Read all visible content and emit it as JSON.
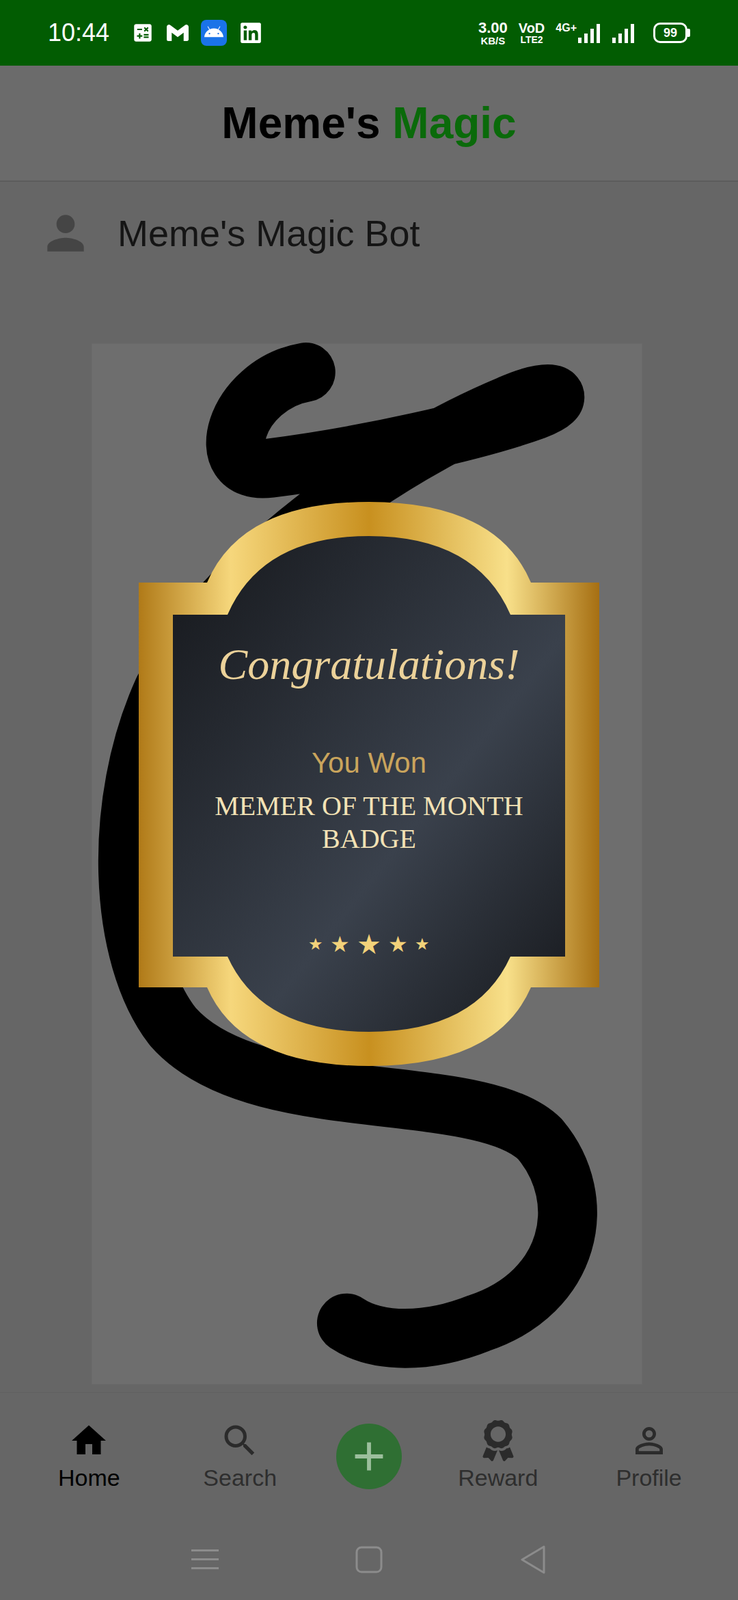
{
  "status_bar": {
    "time": "10:44",
    "net_speed": "3.00",
    "net_unit": "KB/S",
    "volte": "VoD",
    "volte_sub": "LTE2",
    "network": "4G+",
    "battery": "99"
  },
  "header": {
    "title_part1": "Meme's",
    "title_part2": "Magic"
  },
  "post": {
    "author": "Meme's Magic Bot"
  },
  "badge": {
    "heading": "Congratulations!",
    "subheading": "You Won",
    "title": "MEMER OF THE MONTH BADGE",
    "stars": 5
  },
  "nav": [
    {
      "kind": "tab",
      "label": "Home",
      "selected": true
    },
    {
      "kind": "tab",
      "label": "Search",
      "selected": false
    },
    {
      "kind": "add",
      "selected": false
    },
    {
      "kind": "tab",
      "label": "Reward",
      "selected": false
    },
    {
      "kind": "tab",
      "label": "Profile",
      "selected": false
    }
  ]
}
